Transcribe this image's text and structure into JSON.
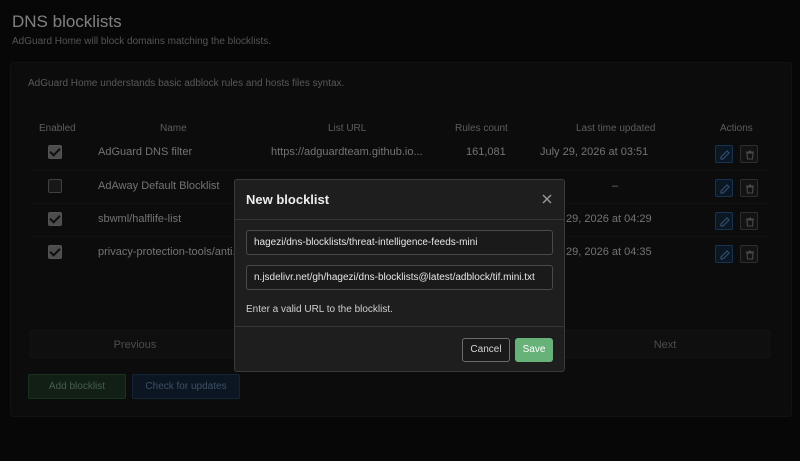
{
  "page": {
    "title": "DNS blocklists",
    "subtitle": "AdGuard Home will block domains matching the blocklists.",
    "description": "AdGuard Home understands basic adblock rules and hosts files syntax."
  },
  "table": {
    "headers": {
      "enabled": "Enabled",
      "name": "Name",
      "url": "List URL",
      "rules": "Rules count",
      "updated": "Last time updated",
      "actions": "Actions"
    },
    "rows": [
      {
        "enabled": true,
        "name": "AdGuard DNS filter",
        "url": "https://adguardteam.github.io...",
        "rules": "161,081",
        "updated": "July 29, 2026 at 03:51"
      },
      {
        "enabled": false,
        "name": "AdAway Default Blocklist",
        "url": "",
        "rules": "",
        "updated": "–"
      },
      {
        "enabled": true,
        "name": "sbwml/halflife-list",
        "url": "",
        "rules": "",
        "updated": "29, 2026 at 04:29"
      },
      {
        "enabled": true,
        "name": "privacy-protection-tools/anti...",
        "url": "",
        "rules": "",
        "updated": "29, 2026 at 04:35"
      }
    ]
  },
  "pagination": {
    "previous": "Previous",
    "next": "Next"
  },
  "buttons": {
    "add": "Add blocklist",
    "check_updates": "Check for updates"
  },
  "modal": {
    "title": "New blocklist",
    "name_value": "hagezi/dns-blocklists/threat-intelligence-feeds-mini",
    "url_value": "n.jsdelivr.net/gh/hagezi/dns-blocklists@latest/adblock/tif.mini.txt",
    "hint": "Enter a valid URL to the blocklist.",
    "cancel": "Cancel",
    "save": "Save"
  },
  "colors": {
    "save_button": "#67b279",
    "edit_action": "#2a5d98",
    "background": "#0d0d0d",
    "modal_background": "#1e1e1e"
  },
  "icons": {
    "close": "close-icon",
    "edit": "pencil-icon",
    "delete": "trash-icon"
  }
}
